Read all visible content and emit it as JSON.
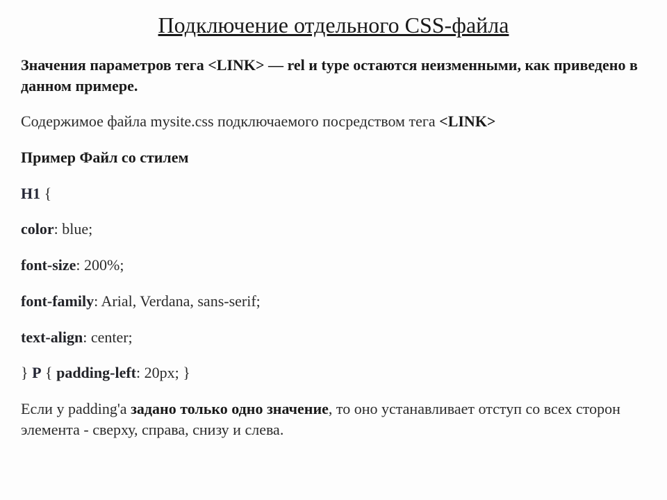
{
  "title": "Подключение отдельного CSS-файла",
  "p1": {
    "t1": "Значения параметров тега ",
    "tag": "<LINK>",
    "t2": " — rel и type остаются неизменными, как приведено в данном примере."
  },
  "p2": {
    "t1": "Содержимое файла mysite.css подключаемого посредством тега ",
    "tag": "<LINK>"
  },
  "p3": "Пример Файл со стилем",
  "css": {
    "line1": {
      "sel": "H1",
      "space": "  ",
      "brace": "{"
    },
    "line2": {
      "prop": "color",
      "rest": ": blue;"
    },
    "line3": {
      "prop": "font-size",
      "rest": ": 200%;"
    },
    "line4": {
      "lead": " ",
      "prop": "font-family",
      "rest": ": Arial, Verdana, sans-serif;"
    },
    "line5": {
      "prop": "text-align",
      "rest": ": center;"
    },
    "line6": {
      "b1": "} ",
      "sel": "P",
      "b2": " { ",
      "prop": "padding-left",
      "rest": ": 20px; }"
    }
  },
  "p_last": {
    "lead": " Если у padding'а ",
    "bold": "задано только одно значение",
    "tail": ", то оно устанавливает отступ со всех сторон элемента - сверху, справа, снизу и слева."
  }
}
